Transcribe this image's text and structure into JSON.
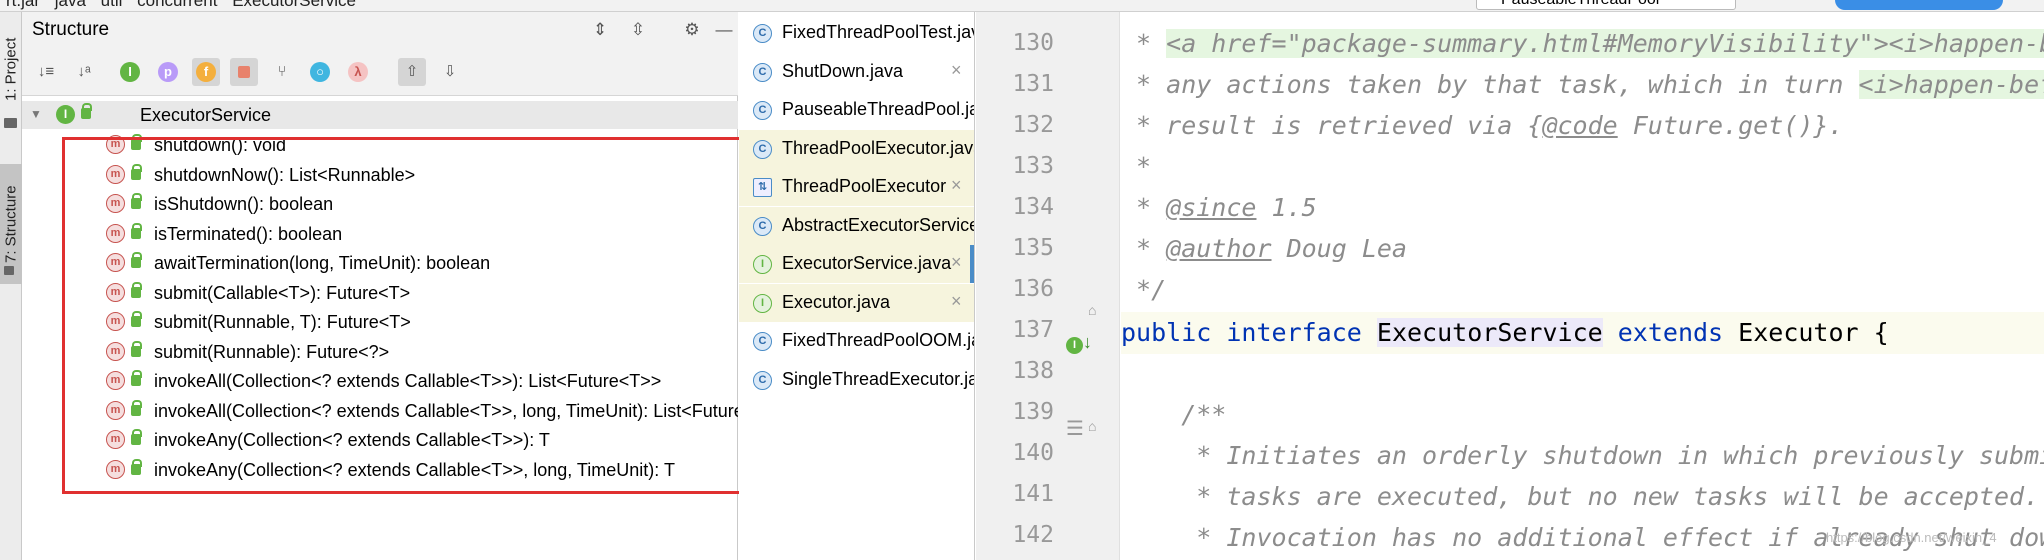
{
  "breadcrumb": {
    "items": [
      "rt.jar",
      "java",
      "util",
      "concurrent",
      "ExecutorService"
    ]
  },
  "toolbar": {
    "run_config": "PauseableThreadPool"
  },
  "side_tabs": {
    "project": "1: Project",
    "structure": "7: Structure"
  },
  "structure": {
    "title": "Structure",
    "root": "ExecutorService",
    "methods": [
      "shutdown(): void",
      "shutdownNow(): List<Runnable>",
      "isShutdown(): boolean",
      "isTerminated(): boolean",
      "awaitTermination(long, TimeUnit): boolean",
      "submit(Callable<T>): Future<T>",
      "submit(Runnable, T): Future<T>",
      "submit(Runnable): Future<?>",
      "invokeAll(Collection<? extends Callable<T>>): List<Future<T>>",
      "invokeAll(Collection<? extends Callable<T>>, long, TimeUnit): List<Future<T>>",
      "invokeAny(Collection<? extends Callable<T>>): T",
      "invokeAny(Collection<? extends Callable<T>>, long, TimeUnit): T"
    ],
    "method_icon": "m",
    "interface_icon": "I"
  },
  "tabs": [
    {
      "name": "FixedThreadPoolTest.java",
      "icon": "class-icon"
    },
    {
      "name": "ShutDown.java",
      "icon": "class-icon"
    },
    {
      "name": "PauseableThreadPool.java",
      "icon": "class-icon"
    },
    {
      "name": "ThreadPoolExecutor.java",
      "icon": "class-icon"
    },
    {
      "name": "ThreadPoolExecutor",
      "icon": "diagram-icon"
    },
    {
      "name": "AbstractExecutorService.java",
      "icon": "class-icon"
    },
    {
      "name": "ExecutorService.java",
      "icon": "interface-icon"
    },
    {
      "name": "Executor.java",
      "icon": "interface-icon"
    },
    {
      "name": "FixedThreadPoolOOM.java",
      "icon": "class-icon"
    },
    {
      "name": "SingleThreadExecutor.java",
      "icon": "class-icon"
    }
  ],
  "close_glyph": "×",
  "editor": {
    "line_numbers": [
      "130",
      "131",
      "132",
      "133",
      "134",
      "135",
      "136",
      "137",
      "138",
      "139",
      "140",
      "141",
      "142"
    ],
    "lines": {
      "l130_star": " * ",
      "l130_html": "<a href=\"package-summary.html#MemoryVisibility\"><i>happen-before</i></a>",
      "l131_text": " * any actions taken by that task, which in turn ",
      "l131_html": "<i>happen-before</i>",
      "l132_a": " * result is retrieved via {",
      "l132_tag": "@code",
      "l132_b": " Future.get()}.",
      "l133": " *",
      "l134_a": " * ",
      "l134_tag": "@since",
      "l134_b": " 1.5",
      "l135_a": " * ",
      "l135_tag": "@author",
      "l135_b": " Doug Lea",
      "l136": " */",
      "l137_kw1": "public",
      "l137_kw2": "interface",
      "l137_name": "ExecutorService",
      "l137_kw3": "extends",
      "l137_rest": "Executor {",
      "l139": "    /**",
      "l140": "     * Initiates an orderly shutdown in which previously submitted",
      "l141": "     * tasks are executed, but no new tasks will be accepted.",
      "l142": "     * Invocation has no additional effect if already shut down."
    }
  },
  "watermark": "https://blog.csdn.net/weixin_4"
}
